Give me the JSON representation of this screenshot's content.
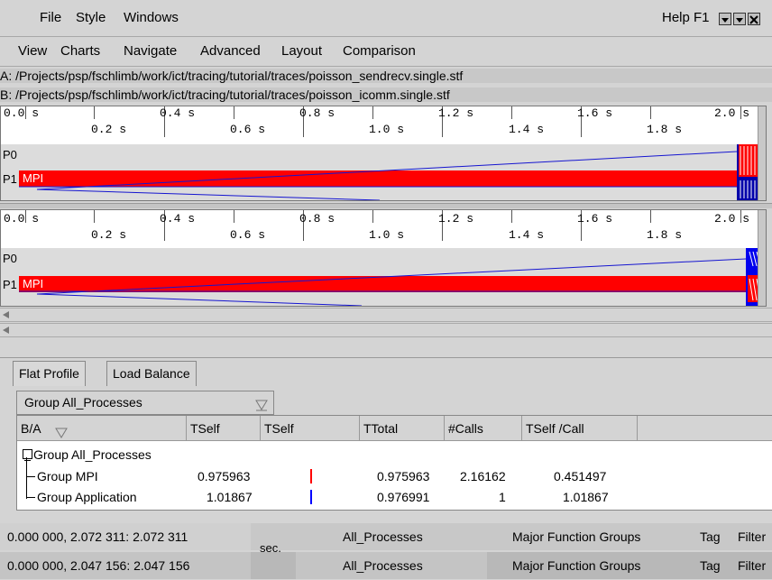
{
  "menubar_main": {
    "items": [
      {
        "label": "File"
      },
      {
        "label": "Style"
      },
      {
        "label": "Windows"
      }
    ],
    "help_label": "Help F1",
    "window_controls": [
      "minimize-icon",
      "maximize-icon",
      "close-icon"
    ]
  },
  "menubar_chart": {
    "items": [
      {
        "label": "View"
      },
      {
        "label": "Charts"
      },
      {
        "label": "Navigate"
      },
      {
        "label": "Advanced"
      },
      {
        "label": "Layout"
      },
      {
        "label": "Comparison"
      }
    ]
  },
  "paths": {
    "a": "A: /Projects/psp/fschlimb/work/ict/tracing/tutorial/traces/poisson_sendrecv.single.stf",
    "b": "B: /Projects/psp/fschlimb/work/ict/tracing/tutorial/traces/poisson_icomm.single.stf"
  },
  "timeline": {
    "ticks_upper": [
      "0.0 s",
      "0.4 s",
      "0.8 s",
      "1.2 s",
      "1.6 s",
      "2.0 s"
    ],
    "ticks_lower": [
      "0.2 s",
      "0.6 s",
      "1.0 s",
      "1.4 s",
      "1.8 s"
    ]
  },
  "chart_a": {
    "processes": [
      "P0",
      "P1"
    ],
    "mpi_label": "MPI"
  },
  "chart_b": {
    "processes": [
      "P0",
      "P1"
    ],
    "mpi_label": "MPI"
  },
  "colors": {
    "mpi": "#ff0000",
    "application": "#0000ff",
    "message_line": "#1515d0"
  },
  "profile": {
    "tabs": [
      {
        "label": "Flat Profile"
      },
      {
        "label": "Load Balance"
      }
    ],
    "group_select": "Group All_Processes",
    "columns": [
      "B/A",
      "TSelf",
      "TSelf",
      "TTotal",
      "#Calls",
      "TSelf /Call"
    ],
    "tree_root": "Group All_Processes",
    "rows": [
      {
        "name": "Group MPI",
        "tself": "0.975963",
        "ttotal": "0.975963",
        "calls": "2.16162",
        "tself_call": "0.451497"
      },
      {
        "name": "Group Application",
        "tself": "1.01867",
        "ttotal": "0.976991",
        "calls": "1",
        "tself_call": "1.01867"
      }
    ]
  },
  "status": {
    "a_range": "0.000 000, 2.072 311: 2.072 311",
    "b_range": "0.000 000, 2.047 156: 2.047 156",
    "unit": "sec.",
    "processes": "All_Processes",
    "grouping": "Major Function Groups",
    "tag": "Tag",
    "filter": "Filter"
  }
}
